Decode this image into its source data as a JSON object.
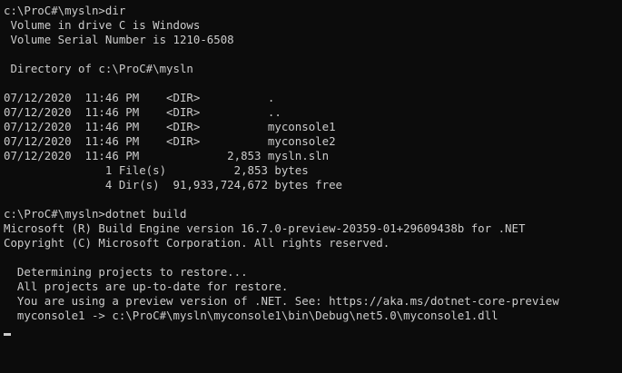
{
  "terminal": {
    "lines": [
      "c:\\ProC#\\mysln>dir",
      " Volume in drive C is Windows",
      " Volume Serial Number is 1210-6508",
      "",
      " Directory of c:\\ProC#\\mysln",
      "",
      "07/12/2020  11:46 PM    <DIR>          .",
      "07/12/2020  11:46 PM    <DIR>          ..",
      "07/12/2020  11:46 PM    <DIR>          myconsole1",
      "07/12/2020  11:46 PM    <DIR>          myconsole2",
      "07/12/2020  11:46 PM             2,853 mysln.sln",
      "               1 File(s)          2,853 bytes",
      "               4 Dir(s)  91,933,724,672 bytes free",
      "",
      "c:\\ProC#\\mysln>dotnet build",
      "Microsoft (R) Build Engine version 16.7.0-preview-20359-01+29609438b for .NET",
      "Copyright (C) Microsoft Corporation. All rights reserved.",
      "",
      "  Determining projects to restore...",
      "  All projects are up-to-date for restore.",
      "  You are using a preview version of .NET. See: https://aka.ms/dotnet-core-preview",
      "  myconsole1 -> c:\\ProC#\\mysln\\myconsole1\\bin\\Debug\\net5.0\\myconsole1.dll",
      ""
    ],
    "colors": {
      "background": "#0c0c0c",
      "foreground": "#cccccc",
      "cursor": "#cccccc"
    }
  }
}
